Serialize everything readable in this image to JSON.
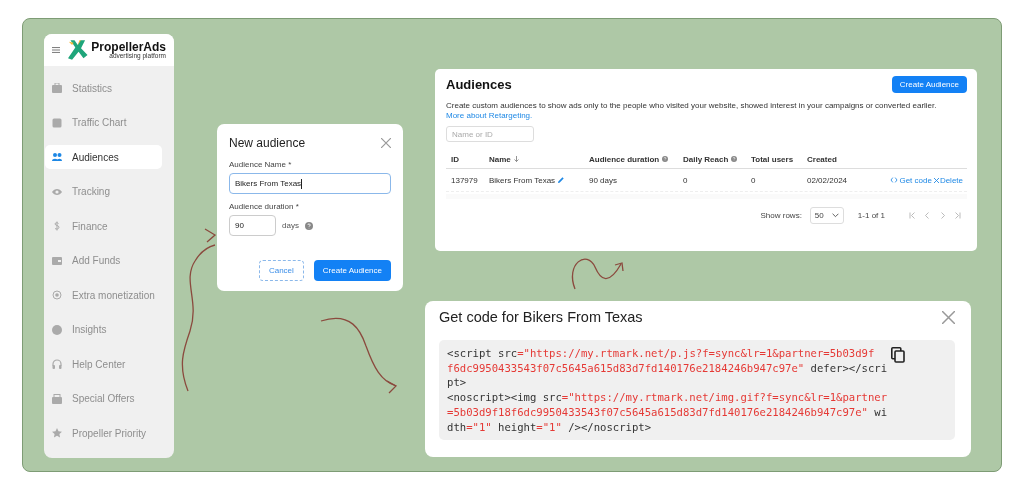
{
  "sidebar": {
    "logo": {
      "name": "PropellerAds",
      "tagline": "advertising platform"
    },
    "items": [
      {
        "label": "Statistics",
        "selected": false
      },
      {
        "label": "Traffic Chart",
        "selected": false
      },
      {
        "label": "Audiences",
        "selected": true
      },
      {
        "label": "Tracking",
        "selected": false
      },
      {
        "label": "Finance",
        "selected": false
      },
      {
        "label": "Add Funds",
        "selected": false
      },
      {
        "label": "Extra monetization",
        "selected": false
      },
      {
        "label": "Insights",
        "selected": false
      },
      {
        "label": "Help Center",
        "selected": false
      },
      {
        "label": "Special Offers",
        "selected": false
      },
      {
        "label": "Propeller Priority",
        "selected": false
      }
    ]
  },
  "new_audience_dialog": {
    "title": "New audience",
    "name_label": "Audience Name *",
    "name_value": "Bikers From Texas",
    "duration_label": "Audience duration *",
    "duration_value": "90",
    "duration_unit": "days",
    "buttons": [
      {
        "label": "Cancel",
        "kind": "secondary"
      },
      {
        "label": "Create Audience",
        "kind": "primary"
      }
    ]
  },
  "audiences_page": {
    "title": "Audiences",
    "create_button": "Create Audience",
    "description": "Create custom audiences to show ads only to the people who visited your website, showed interest in your campaigns or converted earlier.",
    "link": "More about Retargeting.",
    "search": {
      "placeholder": "Name or ID"
    },
    "table": {
      "columns": [
        {
          "label": "ID",
          "help": false,
          "sorted": false
        },
        {
          "label": "Name",
          "help": false,
          "sorted": true
        },
        {
          "label": "Audience duration",
          "help": true,
          "sorted": false
        },
        {
          "label": "Daily Reach",
          "help": true,
          "sorted": false
        },
        {
          "label": "Total users",
          "help": false,
          "sorted": false
        },
        {
          "label": "Created",
          "help": false,
          "sorted": false
        }
      ],
      "rows": [
        {
          "cells": [
            "137979",
            "Bikers From Texas",
            "90 days",
            "0",
            "0",
            "02/02/2024"
          ],
          "actions": [
            {
              "label": "Get code",
              "kind": "code"
            },
            {
              "label": "Delete",
              "kind": "delete"
            }
          ]
        }
      ]
    },
    "pagination": {
      "show_rows_label": "Show rows:",
      "rows_value": "50",
      "range": "1-1 of 1"
    }
  },
  "get_code_dialog": {
    "title": "Get code for Bikers From Texas",
    "code_lines": [
      [
        {
          "text": "<script src",
          "kind": "plain"
        },
        {
          "text": "=\"https://my.rtmark.net/p.js?f=sync&lr=1&partner=5b03d9f",
          "kind": "string"
        }
      ],
      [
        {
          "text": "f6dc9950433543f07c5645a615d83d7fd140176e2184246b947c97e\"",
          "kind": "string"
        },
        {
          "text": " defer></scri",
          "kind": "plain"
        }
      ],
      [
        {
          "text": "pt>",
          "kind": "plain"
        }
      ],
      [
        {
          "text": "<noscript><img src",
          "kind": "plain"
        },
        {
          "text": "=\"https://my.rtmark.net/img.gif?f=sync&lr=1&partner",
          "kind": "string"
        }
      ],
      [
        {
          "text": "=5b03d9f18f6dc9950433543f07c5645a615d83d7fd140176e2184246b947c97e\"",
          "kind": "string"
        },
        {
          "text": " wi",
          "kind": "plain"
        }
      ],
      [
        {
          "text": "dth",
          "kind": "plain"
        },
        {
          "text": "=\"1\"",
          "kind": "string"
        },
        {
          "text": " height",
          "kind": "plain"
        },
        {
          "text": "=\"1\"",
          "kind": "string"
        },
        {
          "text": " /></noscript>",
          "kind": "plain"
        }
      ]
    ]
  }
}
